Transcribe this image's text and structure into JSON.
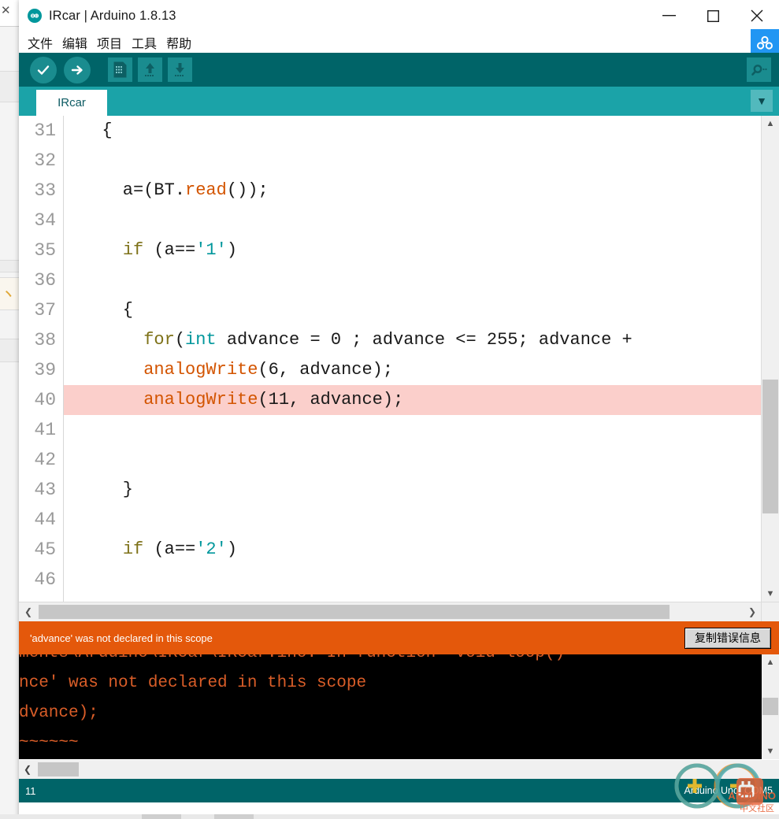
{
  "window": {
    "title": "IRcar | Arduino 1.8.13",
    "logo_icon": "arduino-logo-icon",
    "controls": {
      "minimize": "minimize-icon",
      "maximize": "maximize-icon",
      "close": "close-icon"
    },
    "float_app_icon": "app-icon"
  },
  "menubar": {
    "items": [
      {
        "label": "文件"
      },
      {
        "label": "编辑"
      },
      {
        "label": "项目"
      },
      {
        "label": "工具"
      },
      {
        "label": "帮助"
      }
    ]
  },
  "toolbar": {
    "buttons": [
      {
        "name": "verify-button",
        "icon": "checkmark-icon"
      },
      {
        "name": "upload-button",
        "icon": "arrow-right-icon"
      },
      {
        "name": "new-button",
        "icon": "new-file-icon"
      },
      {
        "name": "open-button",
        "icon": "arrow-up-icon"
      },
      {
        "name": "save-button",
        "icon": "arrow-down-icon"
      }
    ],
    "serial_monitor": {
      "name": "serial-monitor-button",
      "icon": "magnifier-icon"
    }
  },
  "tabs": {
    "active": "IRcar",
    "menu_icon": "chevron-down-icon"
  },
  "editor": {
    "line_numbers": [
      "31",
      "32",
      "33",
      "34",
      "35",
      "36",
      "37",
      "38",
      "39",
      "40",
      "41",
      "42",
      "43",
      "44",
      "45",
      "46"
    ],
    "lines": [
      {
        "n": "31",
        "tokens": [
          {
            "t": "  {",
            "c": ""
          }
        ],
        "error": false
      },
      {
        "n": "32",
        "tokens": [
          {
            "t": "",
            "c": ""
          }
        ],
        "error": false
      },
      {
        "n": "33",
        "tokens": [
          {
            "t": "    a=(BT.",
            "c": ""
          },
          {
            "t": "read",
            "c": "fn"
          },
          {
            "t": "());",
            "c": ""
          }
        ],
        "error": false
      },
      {
        "n": "34",
        "tokens": [
          {
            "t": "",
            "c": ""
          }
        ],
        "error": false
      },
      {
        "n": "35",
        "tokens": [
          {
            "t": "    ",
            "c": ""
          },
          {
            "t": "if",
            "c": "kw"
          },
          {
            "t": " (a==",
            "c": ""
          },
          {
            "t": "'1'",
            "c": "chr"
          },
          {
            "t": ")",
            "c": ""
          }
        ],
        "error": false
      },
      {
        "n": "36",
        "tokens": [
          {
            "t": "",
            "c": ""
          }
        ],
        "error": false
      },
      {
        "n": "37",
        "tokens": [
          {
            "t": "    {",
            "c": ""
          }
        ],
        "error": false
      },
      {
        "n": "38",
        "tokens": [
          {
            "t": "      ",
            "c": ""
          },
          {
            "t": "for",
            "c": "kw"
          },
          {
            "t": "(",
            "c": ""
          },
          {
            "t": "int",
            "c": "type"
          },
          {
            "t": " advance = 0 ; advance <= 255; advance +",
            "c": ""
          }
        ],
        "error": false
      },
      {
        "n": "39",
        "tokens": [
          {
            "t": "      ",
            "c": ""
          },
          {
            "t": "analogWrite",
            "c": "fn"
          },
          {
            "t": "(6, advance);",
            "c": ""
          }
        ],
        "error": false
      },
      {
        "n": "40",
        "tokens": [
          {
            "t": "      ",
            "c": ""
          },
          {
            "t": "analogWrite",
            "c": "fn"
          },
          {
            "t": "(11, advance);",
            "c": ""
          }
        ],
        "error": true
      },
      {
        "n": "41",
        "tokens": [
          {
            "t": "",
            "c": ""
          }
        ],
        "error": false
      },
      {
        "n": "42",
        "tokens": [
          {
            "t": "",
            "c": ""
          }
        ],
        "error": false
      },
      {
        "n": "43",
        "tokens": [
          {
            "t": "    }",
            "c": ""
          }
        ],
        "error": false
      },
      {
        "n": "44",
        "tokens": [
          {
            "t": "",
            "c": ""
          }
        ],
        "error": false
      },
      {
        "n": "45",
        "tokens": [
          {
            "t": "    ",
            "c": ""
          },
          {
            "t": "if",
            "c": "kw"
          },
          {
            "t": " (a==",
            "c": ""
          },
          {
            "t": "'2'",
            "c": "chr"
          },
          {
            "t": ")",
            "c": ""
          }
        ],
        "error": false
      },
      {
        "n": "46",
        "tokens": [
          {
            "t": "",
            "c": ""
          }
        ],
        "error": false
      }
    ]
  },
  "error_bar": {
    "message": "'advance' was not declared in this scope",
    "copy_button": "复制错误信息"
  },
  "console": {
    "lines": [
      "ments\\Arduino\\IRcar\\IRcar.ino: In function 'void loop()'",
      "nce' was not declared in this scope",
      "dvance);",
      "~~~~~~"
    ]
  },
  "statusbar": {
    "line_number": "11",
    "board": "Arduino Uno, COM5"
  },
  "watermark": {
    "word": "ARDUINO",
    "cn": "中文社区"
  },
  "colors": {
    "toolbar_teal": "#006468",
    "tabstrip_teal": "#1ba3a8",
    "error_orange": "#e4580b",
    "error_line_pink": "#fbcfcb",
    "keyword": "#7e7219",
    "type_teal": "#00979c",
    "function_orange": "#d35400",
    "console_text": "#d95d28"
  }
}
